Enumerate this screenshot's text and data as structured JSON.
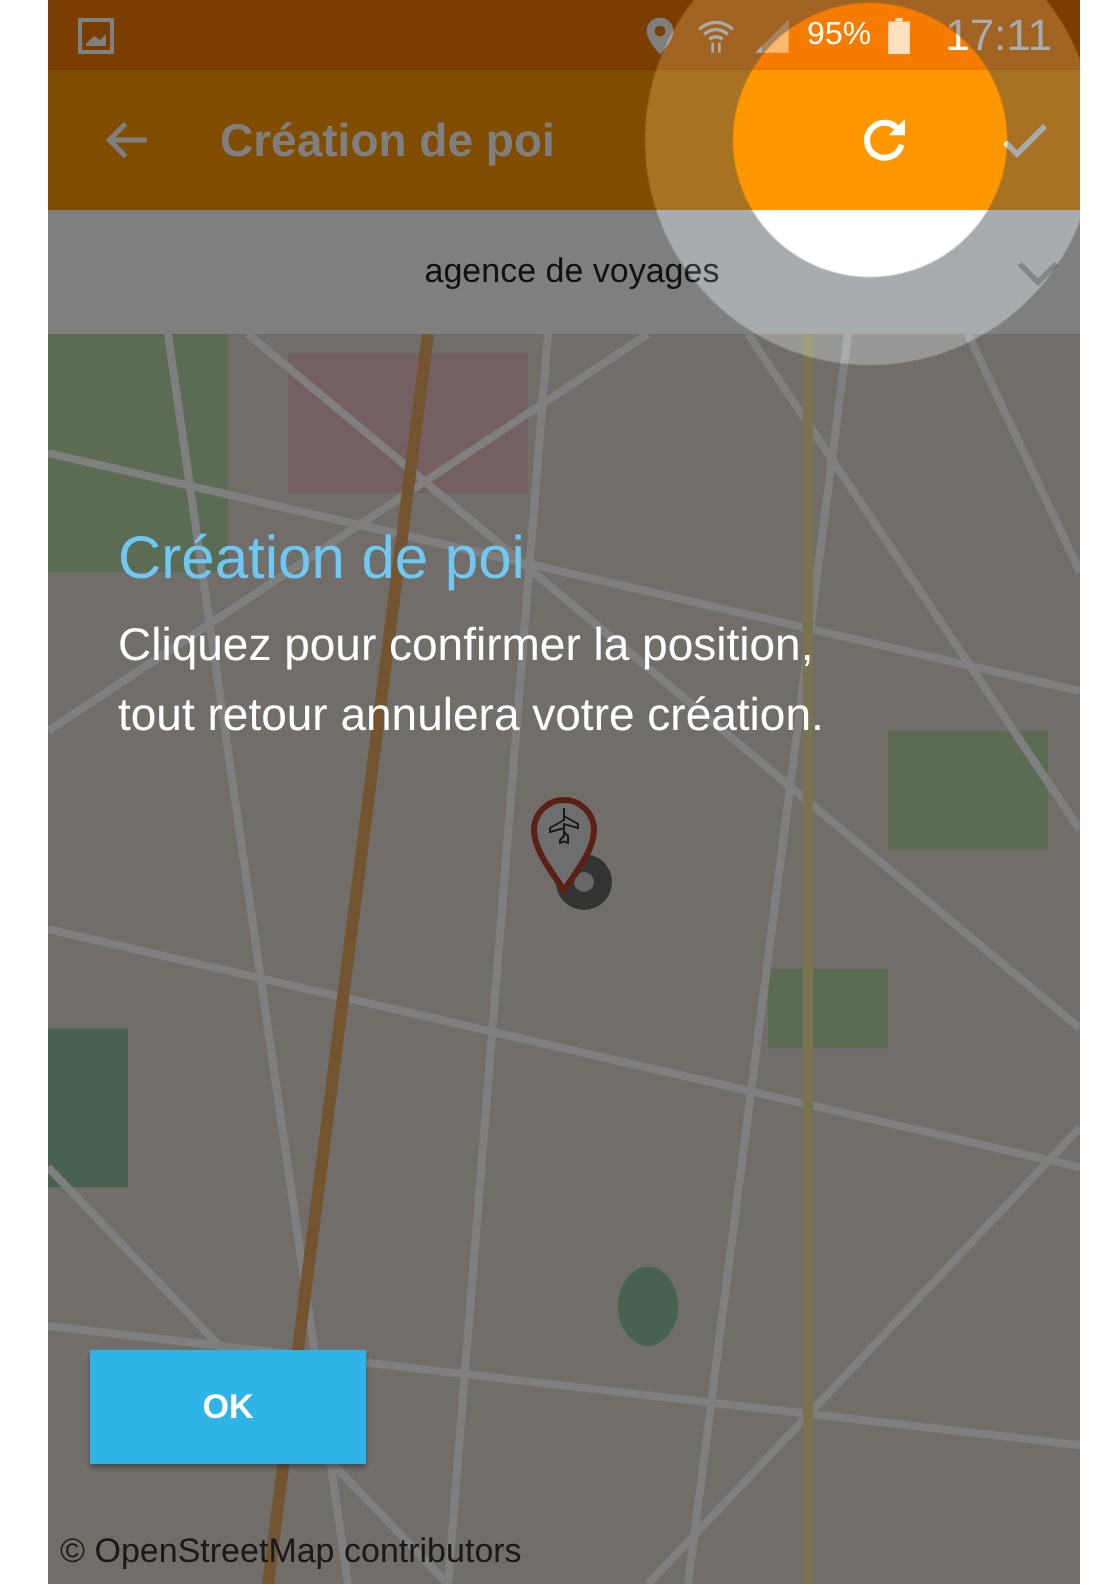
{
  "status_bar": {
    "battery": "95%",
    "time": "17:11"
  },
  "app_bar": {
    "title": "Création de poi"
  },
  "category_spinner": {
    "value": "agence de voyages"
  },
  "map": {
    "attribution": "© OpenStreetMap contributors"
  },
  "showcase": {
    "title": "Création de poi",
    "text": "Cliquez pour confirmer la position, tout retour annulera votre création.",
    "button": "OK"
  }
}
